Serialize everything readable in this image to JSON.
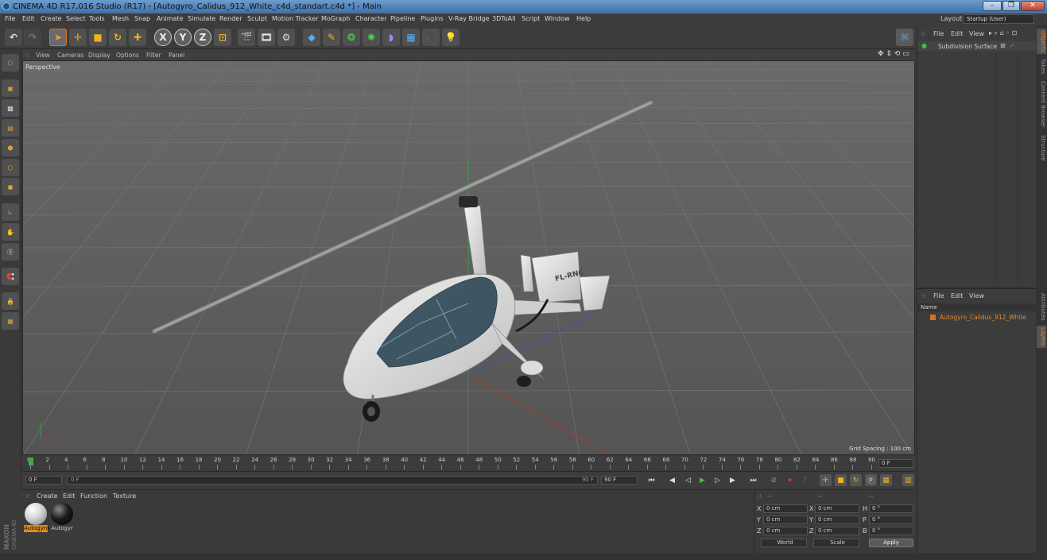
{
  "window": {
    "title": "CINEMA 4D R17.016 Studio (R17) - [Autogyro_Calidus_912_White_c4d_standart.c4d *] - Main",
    "controls": [
      "–",
      "❐",
      "✕"
    ]
  },
  "menu": {
    "items": [
      "File",
      "Edit",
      "Create",
      "Select",
      "Tools",
      "Mesh",
      "Snap",
      "Animate",
      "Simulate",
      "Render",
      "Sculpt",
      "Motion Tracker",
      "MoGraph",
      "Character",
      "Pipeline",
      "Plugins",
      "V-Ray Bridge",
      "3DToAll",
      "Script",
      "Window",
      "Help"
    ],
    "layout_label": "Layout:",
    "layout_value": "Startup (User)"
  },
  "toolbar": {
    "axis_x": "X",
    "axis_y": "Y",
    "axis_z": "Z"
  },
  "viewport": {
    "menu": [
      "View",
      "Cameras",
      "Display",
      "Options",
      "Filter",
      "Panel"
    ],
    "name": "Perspective",
    "grid_spacing": "Grid Spacing : 100 cm",
    "model_registration": "FL-RNC"
  },
  "timeline": {
    "ticks": [
      "0",
      "2",
      "4",
      "6",
      "8",
      "10",
      "12",
      "14",
      "16",
      "18",
      "20",
      "22",
      "24",
      "26",
      "28",
      "30",
      "32",
      "34",
      "36",
      "38",
      "40",
      "42",
      "44",
      "46",
      "48",
      "50",
      "52",
      "54",
      "56",
      "58",
      "60",
      "62",
      "64",
      "66",
      "68",
      "70",
      "72",
      "74",
      "76",
      "78",
      "80",
      "82",
      "84",
      "86",
      "88",
      "90"
    ],
    "current_frame": "0 F"
  },
  "transport": {
    "start": "0 F",
    "slider_start": "0 F",
    "slider_end": "90 F",
    "end": "90 F"
  },
  "materials": {
    "menu": [
      "Create",
      "Edit",
      "Function",
      "Texture"
    ],
    "items": [
      {
        "label": "Autogyro",
        "color": "#d8d8d8",
        "selected": true
      },
      {
        "label": "Autogyr",
        "color": "#1c1c1c",
        "selected": false
      }
    ]
  },
  "coordinates": {
    "header": [
      "--",
      "--",
      "--"
    ],
    "rows": [
      {
        "a": "X",
        "av": "0 cm",
        "b": "X",
        "bv": "0 cm",
        "c": "H",
        "cv": "0 °"
      },
      {
        "a": "Y",
        "av": "0 cm",
        "b": "Y",
        "bv": "0 cm",
        "c": "P",
        "cv": "0 °"
      },
      {
        "a": "Z",
        "av": "0 cm",
        "b": "Z",
        "bv": "0 cm",
        "c": "B",
        "cv": "0 °"
      }
    ],
    "world": "World",
    "scale": "Scale",
    "apply": "Apply"
  },
  "objects": {
    "menu": [
      "File",
      "Edit",
      "View"
    ],
    "items": [
      "Subdivision Surface"
    ]
  },
  "layers": {
    "menu": [
      "File",
      "Edit",
      "View"
    ],
    "column_name": "Name",
    "items": [
      {
        "label": "Autogyro_Calidus_912_White",
        "color": "#d9702a"
      }
    ]
  },
  "side_tabs": [
    "Objects",
    "Takes",
    "Content Browser",
    "Structure",
    "Attributes",
    "Layers"
  ],
  "branding": "MAXON CINEMA 4D"
}
